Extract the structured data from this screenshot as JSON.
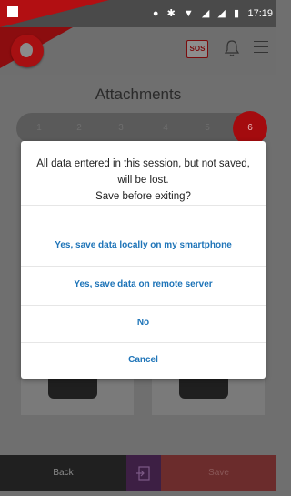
{
  "status_bar": {
    "time": "17:19",
    "icons": [
      "location-icon",
      "bluetooth-icon",
      "wifi-icon",
      "signal-icon",
      "signal-icon-2",
      "battery-icon"
    ]
  },
  "header": {
    "sos_label": "SOS",
    "brand_color": "#e60000"
  },
  "page": {
    "title": "Attachments",
    "steps": [
      "1",
      "2",
      "3",
      "4",
      "5",
      "6"
    ],
    "active_step": "6"
  },
  "dialog": {
    "message_lines": [
      "All data entered in this session, but not saved,",
      "will be lost.",
      "Save before exiting?"
    ],
    "options": [
      "Yes, save data locally on my smartphone",
      "Yes, save data on remote server",
      "No",
      "Cancel"
    ],
    "accent_color": "#1e74b8"
  },
  "bottom_bar": {
    "back_label": "Back",
    "save_label": "Save"
  }
}
